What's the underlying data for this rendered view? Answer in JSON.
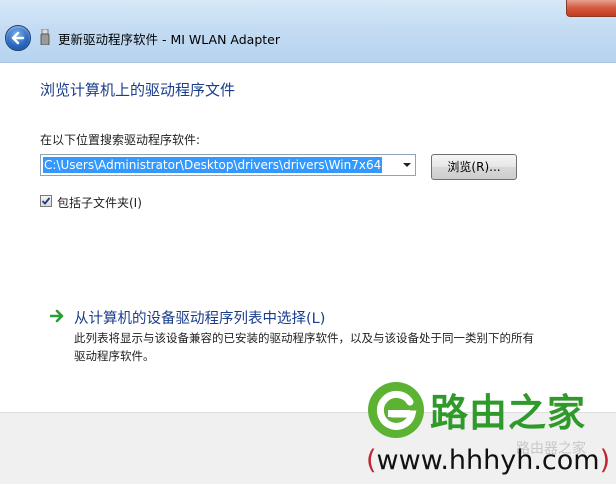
{
  "window": {
    "title": "更新驱动程序软件 - MI WLAN Adapter"
  },
  "page": {
    "heading": "浏览计算机上的驱动程序文件",
    "search_label": "在以下位置搜索驱动程序软件:",
    "path_value": "C:\\Users\\Administrator\\Desktop\\drivers\\drivers\\Win7x64",
    "browse_label": "浏览(R)...",
    "include_subfolders_label": "包括子文件夹(I)",
    "include_subfolders_checked": true,
    "pick_title": "从计算机的设备驱动程序列表中选择(L)",
    "pick_desc": "此列表将显示与该设备兼容的已安装的驱动程序软件，以及与该设备处于同一类别下的所有驱动程序软件。"
  },
  "watermark": {
    "name": "路由之家",
    "faint": "路由器之家",
    "url_open": "(",
    "url": "www.hhhyh.com",
    "url_close": ")"
  },
  "colors": {
    "heading": "#1a3e8c",
    "selection": "#3399ff",
    "logo_green": "#2f9a2a",
    "close_red": "#c43b22"
  },
  "icons": {
    "back": "back-arrow-icon",
    "device": "usb-device-icon",
    "combo": "chevron-down-icon",
    "link": "green-arrow-icon",
    "logo": "router-home-logo-icon"
  }
}
